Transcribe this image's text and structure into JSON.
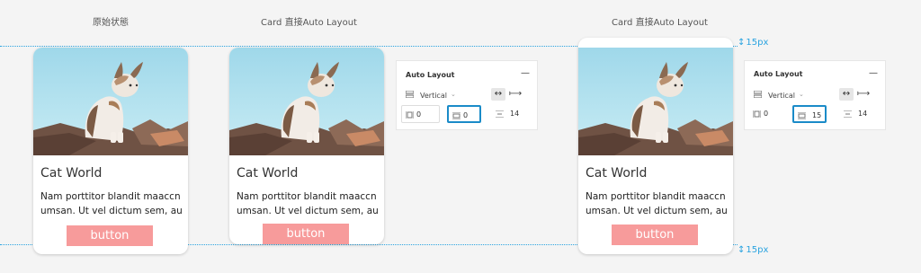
{
  "captions": {
    "original": "原始状態",
    "card_auto_1": "Card  直接Auto Layout",
    "card_auto_2": "Card  直接Auto Layout"
  },
  "guides": {
    "top_label": "15px",
    "bottom_label": "15px",
    "color": "#2aa3e0"
  },
  "card": {
    "title": "Cat World",
    "desc_line1": "Nam porttitor blandit maaccn",
    "desc_line2": "umsan. Ut vel dictum sem, au",
    "button_label": "button",
    "button_color": "#f79b9b"
  },
  "panel_left": {
    "title": "Auto Layout",
    "close": "—",
    "direction": "Vertical",
    "h_padding": "0",
    "v_padding": "0",
    "spacing": "14"
  },
  "panel_right": {
    "title": "Auto Layout",
    "close": "—",
    "direction": "Vertical",
    "h_padding": "0",
    "v_padding": "15",
    "spacing": "14"
  },
  "accent_color": "#1a8bc8"
}
